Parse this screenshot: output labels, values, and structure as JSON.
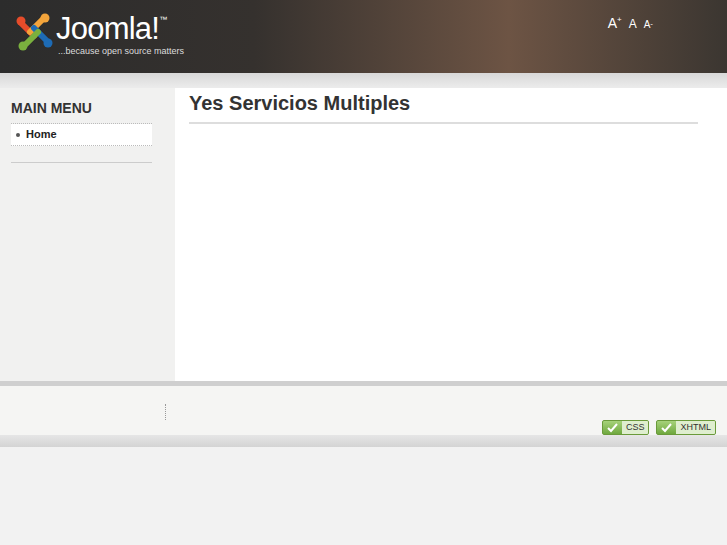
{
  "header": {
    "logo": {
      "name": "Joomla!",
      "tm": "™",
      "tagline": "...because open source matters"
    },
    "font_size_buttons": [
      {
        "label": "A",
        "mark": "+"
      },
      {
        "label": "A",
        "mark": ""
      },
      {
        "label": "A",
        "mark": "-"
      }
    ]
  },
  "sidebar": {
    "title": "MAIN MENU",
    "items": [
      {
        "label": "Home",
        "selected": true
      }
    ]
  },
  "content": {
    "title": "Yes Servicios Multiples"
  },
  "footer": {
    "badges": [
      "CSS",
      "XHTML"
    ]
  }
}
